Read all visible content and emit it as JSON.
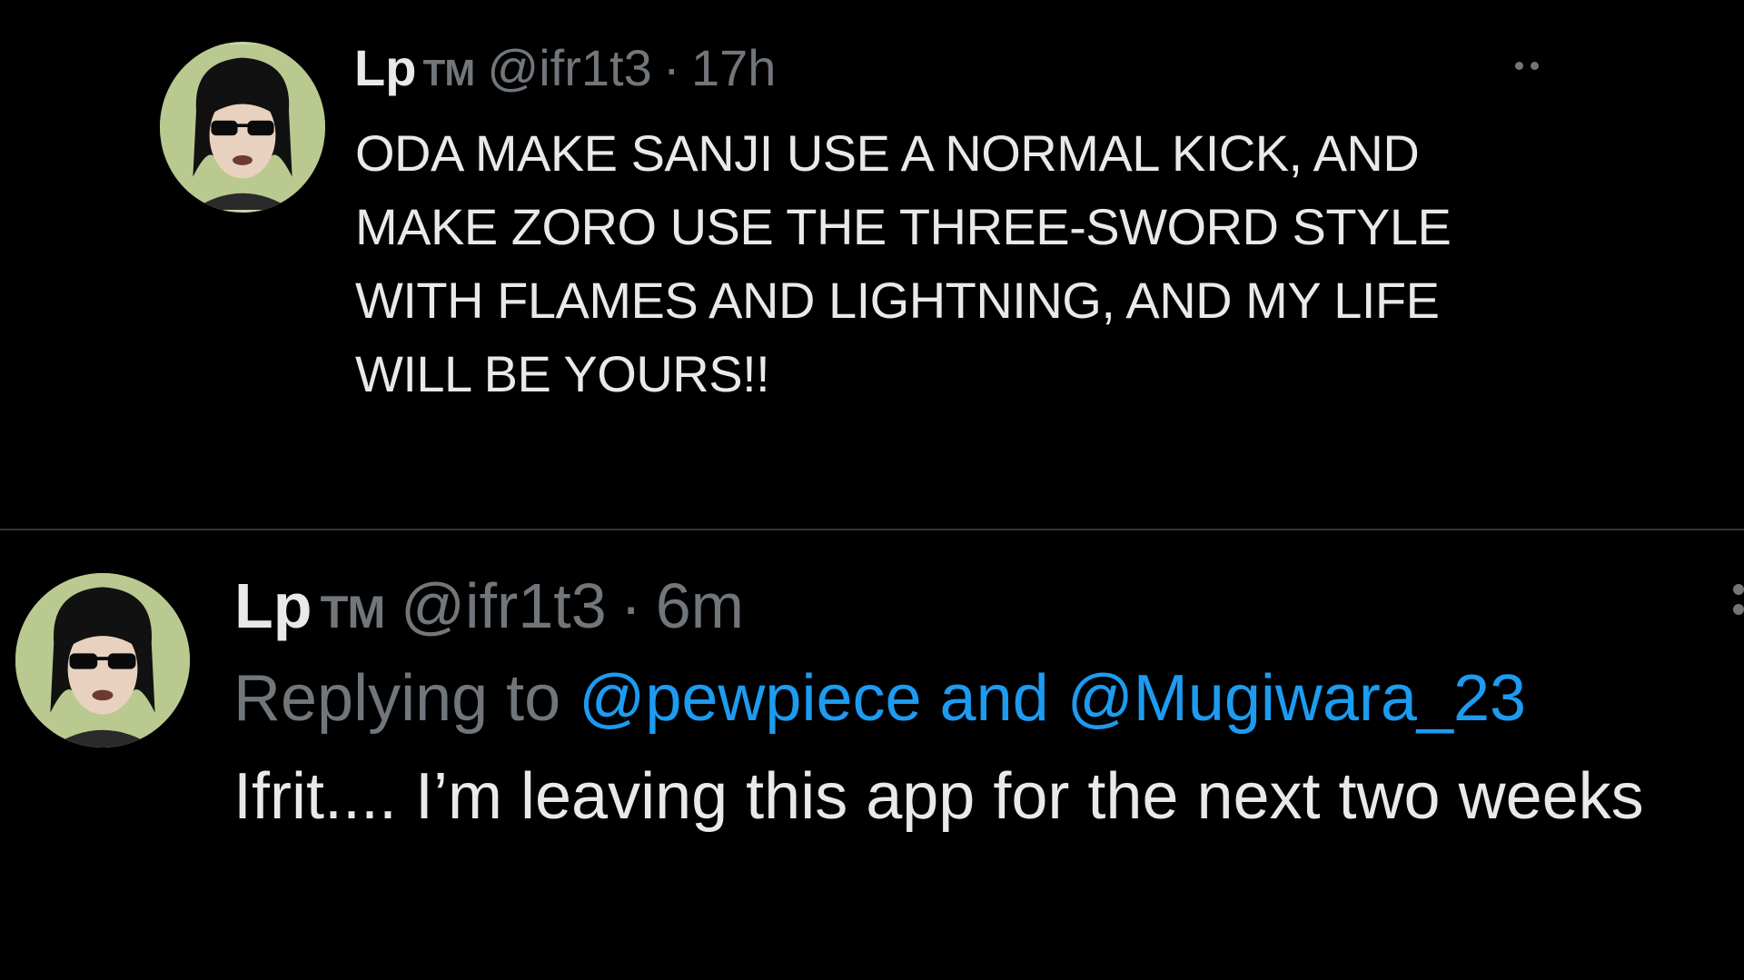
{
  "tweets": [
    {
      "display_name": "Lp",
      "badge": "TM",
      "handle": "@ifr1t3",
      "separator": "·",
      "time": "17h",
      "lines": [
        "ODA MAKE SANJI USE A NORMAL KICK, AND",
        "MAKE ZORO USE THE THREE-SWORD STYLE",
        "WITH FLAMES AND LIGHTNING, AND MY LIFE",
        "WILL BE YOURS!!"
      ],
      "avatar_icon": "user-avatar-sunglasses",
      "more_icon": "more-horizontal-icon"
    },
    {
      "display_name": "Lp",
      "badge": "TM",
      "handle": "@ifr1t3",
      "separator": "·",
      "time": "6m",
      "replying_prefix": "Replying to",
      "mention_1": "@pewpiece",
      "and_word": "and",
      "mention_2": "@Mugiwara_23",
      "text": "Ifrit.... I’m leaving this app for the next two weeks",
      "avatar_icon": "user-avatar-sunglasses",
      "more_icon": "more-vertical-icon"
    }
  ],
  "colors": {
    "background": "#000000",
    "text_primary": "#e7e9ea",
    "text_secondary": "#71767b",
    "link": "#1d9bf0",
    "divider": "#2f3336"
  }
}
